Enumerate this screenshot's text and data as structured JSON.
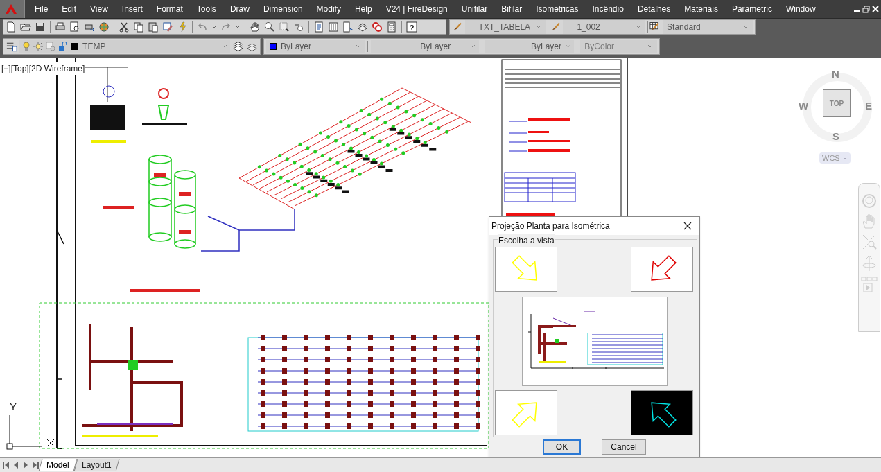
{
  "menu": [
    "File",
    "Edit",
    "View",
    "Insert",
    "Format",
    "Tools",
    "Draw",
    "Dimension",
    "Modify",
    "Help",
    "V24 | FireDesign",
    "Unifilar",
    "Bifilar",
    "Isometricas",
    "Incêndio",
    "Detalhes",
    "Materiais",
    "Parametric",
    "Window"
  ],
  "styles": {
    "text_style": "TXT_TABELA",
    "dim_style": "1_002",
    "table_style": "Standard"
  },
  "help_glyph": "?",
  "properties": {
    "layer": "TEMP",
    "current_fill": "ByLayer",
    "linetype": "ByLayer",
    "lineweight": "ByLayer",
    "plot_style": "ByColor"
  },
  "viewport_label": "[−][Top][2D Wireframe]",
  "viewcube": {
    "north": "N",
    "west": "W",
    "east": "E",
    "south": "S",
    "face": "TOP",
    "ucs": "WCS"
  },
  "ucs_icon": {
    "y": "Y"
  },
  "dialog": {
    "title": "Projeção Planta para Isométrica",
    "group_label": "Escolha a vista",
    "views": [
      {
        "selected": false,
        "color": "#ffff00"
      },
      {
        "selected": false,
        "color": "#e00000"
      },
      {
        "selected": false,
        "color": "#ffff00"
      },
      {
        "selected": true,
        "color": "#00e5e5"
      }
    ],
    "buttons": [
      "OK",
      "Cancel"
    ]
  },
  "tabs": [
    {
      "label": "Model",
      "selected": true
    },
    {
      "label": "Layout1",
      "selected": false
    }
  ]
}
